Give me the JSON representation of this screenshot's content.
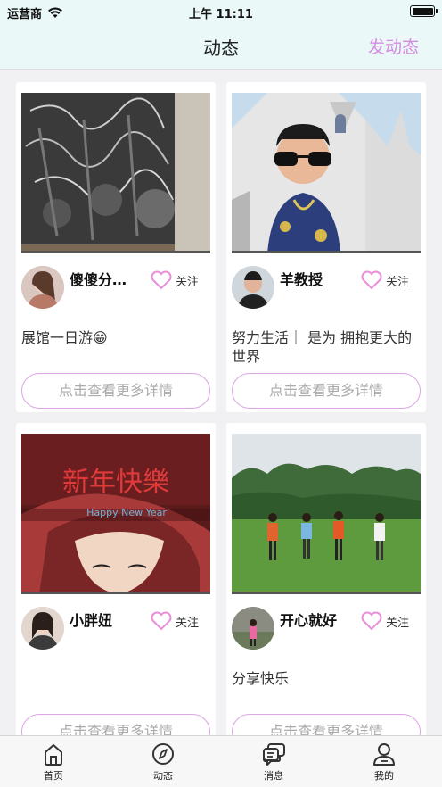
{
  "status": {
    "carrier": "运营商",
    "time": "上午 11:11"
  },
  "nav": {
    "title": "动态",
    "action": "发动态"
  },
  "posts": [
    {
      "username": "傻傻分…",
      "follow_label": "关注",
      "caption": "展馆一日游😁",
      "more_label": "点击查看更多详情"
    },
    {
      "username": "羊教授",
      "follow_label": "关注",
      "caption": "努力生活｜ 是为 拥抱更大的世界",
      "more_label": "点击查看更多详情"
    },
    {
      "username": "小胖妞",
      "follow_label": "关注",
      "caption": "",
      "more_label": "点击查看更多详情",
      "image_text": "新年快樂",
      "image_subtext": "Happy New Year"
    },
    {
      "username": "开心就好",
      "follow_label": "关注",
      "caption": "分享快乐",
      "more_label": "点击查看更多详情"
    }
  ],
  "tabs": [
    {
      "label": "首页",
      "icon": "home-icon"
    },
    {
      "label": "动态",
      "icon": "compass-icon"
    },
    {
      "label": "消息",
      "icon": "chat-icon"
    },
    {
      "label": "我的",
      "icon": "profile-icon"
    }
  ],
  "colors": {
    "header_bg": "#eaf8f8",
    "accent": "#d58be0",
    "heart": "#e98fd9",
    "button_border": "#dda4e6"
  }
}
